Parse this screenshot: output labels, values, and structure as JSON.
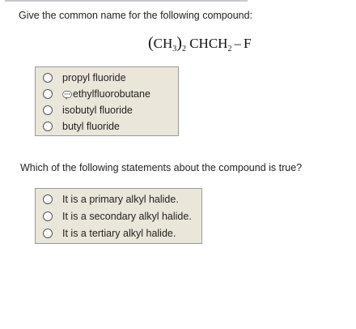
{
  "question1": {
    "prompt": "Give the common name for the following compound:",
    "formula": {
      "group": "CH",
      "group_sub": "3",
      "paren_sub": "2",
      "chain": "CHCH",
      "chain_sub": "2",
      "dash": "–",
      "halogen": "F"
    },
    "options": [
      {
        "label": "propyl fluoride"
      },
      {
        "label": "ethylfluorobutane",
        "icon": "comment-icon"
      },
      {
        "label": "isobutyl fluoride"
      },
      {
        "label": "butyl fluoride"
      }
    ]
  },
  "question2": {
    "prompt": "Which of the following statements about the compound is true?",
    "options": [
      {
        "label": "It is a primary alkyl halide."
      },
      {
        "label": "It is a secondary alkyl halide."
      },
      {
        "label": "It is a tertiary alkyl halide."
      }
    ]
  },
  "colors": {
    "options_background": "#ebe6da",
    "options_border": "#9a9a9a"
  }
}
